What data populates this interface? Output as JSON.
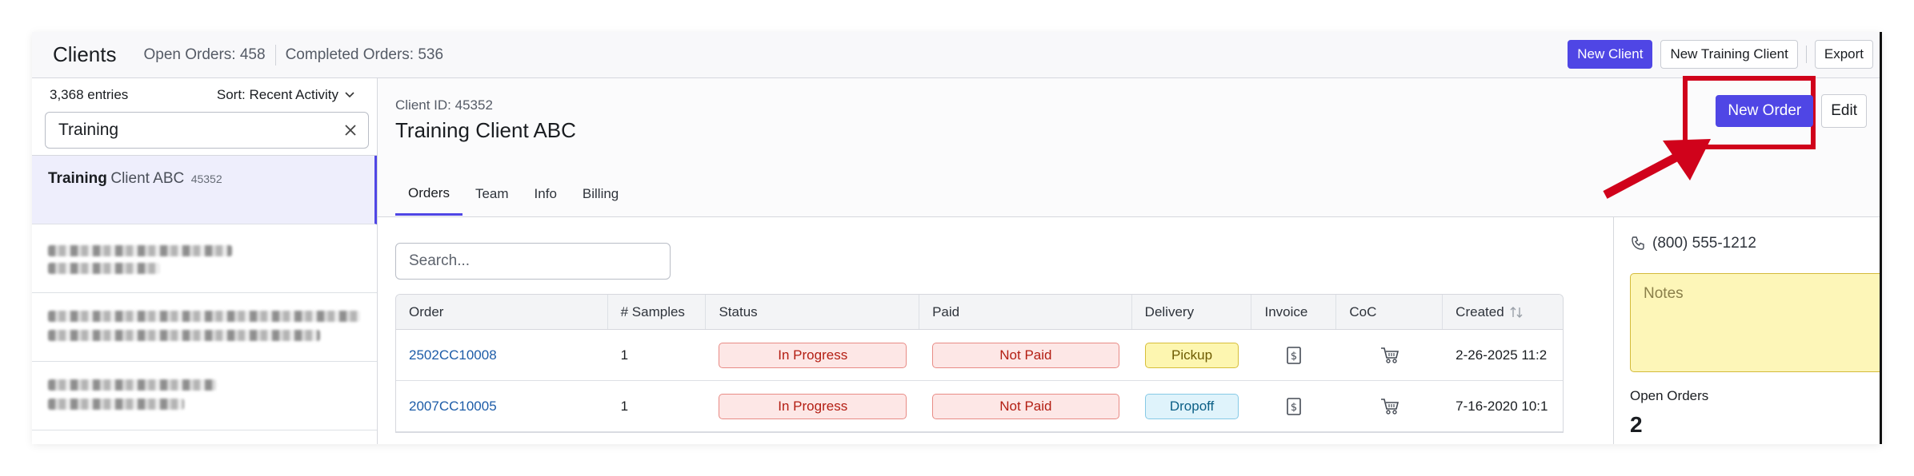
{
  "topbar": {
    "title": "Clients",
    "open_orders": "Open Orders: 458",
    "completed_orders": "Completed Orders: 536",
    "new_client": "New Client",
    "new_training_client": "New Training Client",
    "export": "Export"
  },
  "sidebar": {
    "entries": "3,368 entries",
    "sort": "Sort: Recent Activity",
    "search_value": "Training",
    "items": [
      {
        "name_bold": "Training",
        "name_rest": "Client ABC",
        "id": "45352"
      }
    ]
  },
  "client": {
    "id_label": "Client ID: 45352",
    "name": "Training Client ABC",
    "new_order": "New Order",
    "edit": "Edit",
    "tabs": [
      "Orders",
      "Team",
      "Info",
      "Billing"
    ]
  },
  "orders": {
    "search_placeholder": "Search...",
    "columns": [
      "Order",
      "# Samples",
      "Status",
      "Paid",
      "Delivery",
      "Invoice",
      "CoC",
      "Created"
    ],
    "rows": [
      {
        "order": "2502CC10008",
        "samples": "1",
        "status": "In Progress",
        "paid": "Not Paid",
        "delivery": "Pickup",
        "created": "2-26-2025 11:2"
      },
      {
        "order": "2007CC10005",
        "samples": "1",
        "status": "In Progress",
        "paid": "Not Paid",
        "delivery": "Dropoff",
        "created": "7-16-2020 10:1"
      }
    ]
  },
  "panel": {
    "phone": "(800) 555-1212",
    "notes_placeholder": "Notes",
    "open_orders_label": "Open Orders",
    "open_orders_count": "2"
  },
  "colors": {
    "accent": "#4f46e5",
    "annotation_red": "#d0021b"
  }
}
